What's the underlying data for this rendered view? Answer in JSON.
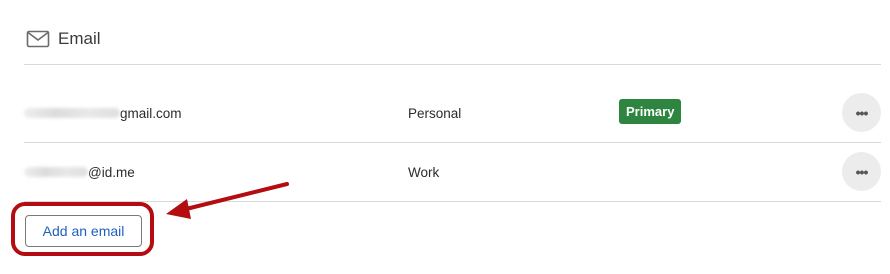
{
  "section": {
    "title": "Email",
    "icon": "mail-icon"
  },
  "emails": [
    {
      "address_visible": "gmail.com",
      "type": "Personal",
      "badge": "Primary",
      "more_label": "•••"
    },
    {
      "address_visible": "@id.me",
      "type": "Work",
      "badge": "",
      "more_label": "•••"
    }
  ],
  "actions": {
    "add_email_label": "Add an email"
  },
  "colors": {
    "primary_badge": "#2e8540",
    "link_blue": "#1f5fbf",
    "annotation_red": "#b30d12"
  }
}
